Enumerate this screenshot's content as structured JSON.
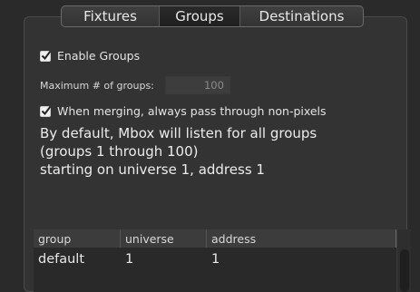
{
  "tabs": [
    {
      "label": "Fixtures",
      "selected": false
    },
    {
      "label": "Groups",
      "selected": true
    },
    {
      "label": "Destinations",
      "selected": false
    }
  ],
  "enable_groups": {
    "label": "Enable Groups",
    "checked": true
  },
  "max_groups": {
    "label": "Maximum # of groups:",
    "value": "100"
  },
  "merge_option": {
    "label": "When merging, always pass through non-pixels",
    "checked": true
  },
  "info_text": "By default, Mbox will listen for all groups\n(groups 1 through 100)\nstarting on universe 1, address 1",
  "table": {
    "columns": [
      "group",
      "universe",
      "address"
    ],
    "rows": [
      {
        "group": "default",
        "universe": "1",
        "address": "1"
      }
    ]
  },
  "colors": {
    "background": "#2a2a2a",
    "panel": "#333333",
    "text": "#e6e6e6",
    "header": "#3c3c3c"
  }
}
